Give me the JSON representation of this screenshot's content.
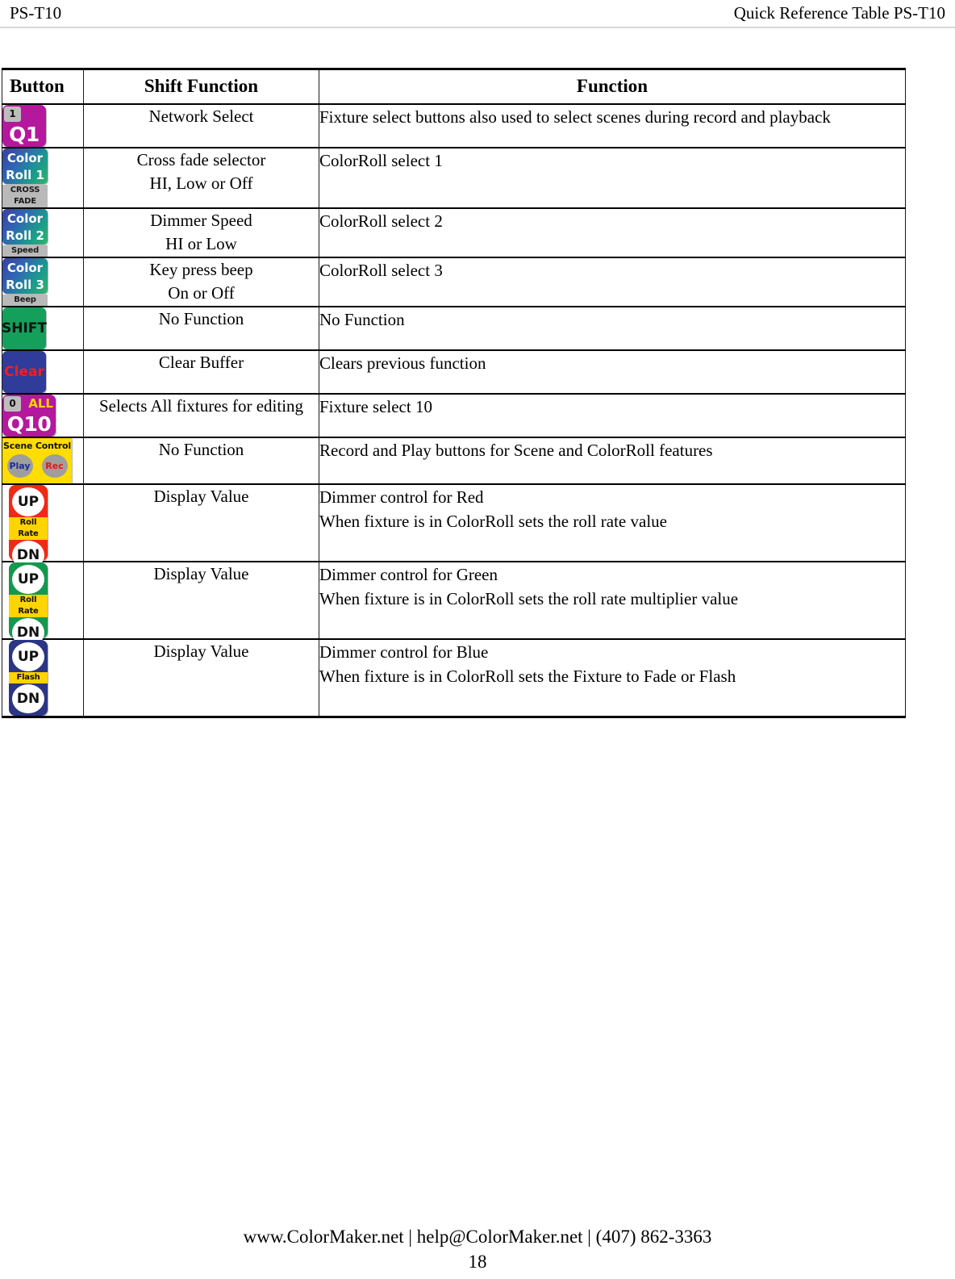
{
  "header": {
    "left": "PS-T10",
    "right": "Quick Reference Table PS-T10"
  },
  "table": {
    "columns": {
      "button": "Button",
      "shift_function": "Shift Function",
      "function": "Function"
    },
    "rows": [
      {
        "button": {
          "type": "fixture-key",
          "badge": "1",
          "label": "Q1",
          "color": "#b4189c"
        },
        "shift_function": [
          "Network Select"
        ],
        "function": [
          "Fixture select buttons also used to select scenes during record and playback"
        ]
      },
      {
        "button": {
          "type": "colorroll-key",
          "line1": "Color",
          "line2": "Roll 1",
          "caption": "CROSS FADE"
        },
        "shift_function": [
          "Cross fade selector",
          "HI, Low or Off"
        ],
        "function": [
          "ColorRoll select 1"
        ]
      },
      {
        "button": {
          "type": "colorroll-key",
          "line1": "Color",
          "line2": "Roll 2",
          "caption": "Speed"
        },
        "shift_function": [
          "Dimmer Speed",
          "HI or Low"
        ],
        "function": [
          "ColorRoll select 2"
        ]
      },
      {
        "button": {
          "type": "colorroll-key",
          "line1": "Color",
          "line2": "Roll 3",
          "caption": "Beep"
        },
        "shift_function": [
          "Key press beep",
          "On or Off"
        ],
        "function": [
          "ColorRoll select 3"
        ]
      },
      {
        "button": {
          "type": "plain-key",
          "label": "SHIFT",
          "color": "#14a05a",
          "text_color": "#111111"
        },
        "shift_function": [
          "No Function"
        ],
        "function": [
          "No Function"
        ]
      },
      {
        "button": {
          "type": "plain-key",
          "label": "Clear",
          "color": "#2f3c99",
          "text_color": "#ff1a1a"
        },
        "shift_function": [
          "Clear Buffer"
        ],
        "function": [
          "Clears previous function"
        ]
      },
      {
        "button": {
          "type": "fixture-key",
          "badge": "0",
          "all_label": "ALL",
          "label": "Q10",
          "color": "#b4189c"
        },
        "shift_function": [
          "Selects All fixtures for editing"
        ],
        "function": [
          "Fixture select 10"
        ]
      },
      {
        "button": {
          "type": "scene-control",
          "title": "Scene Control",
          "play": "Play",
          "rec": "Rec",
          "color": "#ffdd00"
        },
        "shift_function": [
          "No Function"
        ],
        "function": [
          "Record and Play buttons for Scene and ColorRoll features"
        ]
      },
      {
        "button": {
          "type": "rocker",
          "up": "UP",
          "down": "DN",
          "strip": "Roll Rate",
          "color": "#ee2b16"
        },
        "shift_function": [
          "Display Value"
        ],
        "function": [
          "Dimmer control for Red",
          "When fixture is in ColorRoll sets the roll rate value"
        ]
      },
      {
        "button": {
          "type": "rocker",
          "up": "UP",
          "down": "DN",
          "strip": "Roll Rate",
          "color": "#14984f"
        },
        "shift_function": [
          "Display Value"
        ],
        "function": [
          "Dimmer control for Green",
          "When fixture is in ColorRoll sets the roll rate multiplier value"
        ]
      },
      {
        "button": {
          "type": "rocker",
          "up": "UP",
          "down": "DN",
          "strip": "Flash",
          "color": "#2b3584"
        },
        "shift_function": [
          "Display Value"
        ],
        "function": [
          "Dimmer control for Blue",
          "When fixture is in ColorRoll sets the Fixture to Fade or Flash"
        ]
      }
    ]
  },
  "footer": {
    "contact": "www.ColorMaker.net  | help@ColorMaker.net | (407) 862-3363",
    "page_number": "18"
  }
}
